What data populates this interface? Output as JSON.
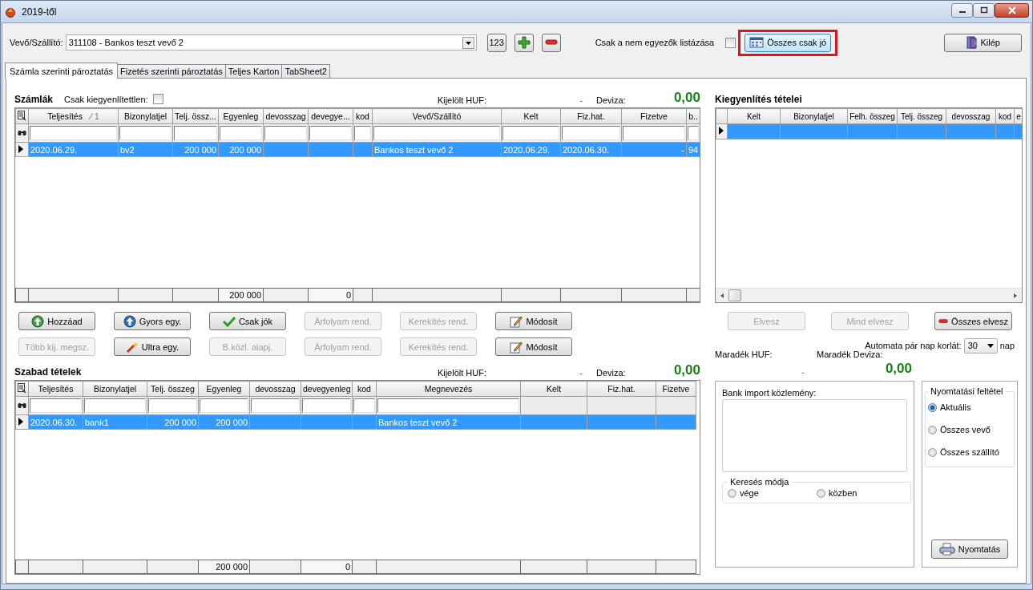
{
  "window": {
    "title": "2019-től"
  },
  "toolbar": {
    "customer_label": "Vevő/Szállító:",
    "customer_value": "311108 - Bankos teszt vevő 2",
    "number_button": "123",
    "mismatch_label": "Csak a nem egyezők listázása",
    "mismatch_checked": false,
    "all_ok_button": {
      "label": "Összes csak jó",
      "highlighted": true
    },
    "exit_button": "Kilép"
  },
  "tabs": [
    {
      "label": "Számla szerinti pároztatás",
      "selected": true
    },
    {
      "label": "Fizetés szerinti pároztatás",
      "selected": false
    },
    {
      "label": "Teljes Karton",
      "selected": false
    },
    {
      "label": "TabSheet2",
      "selected": false
    }
  ],
  "sections": [
    {
      "title": "Számlák",
      "filter_label": "Csak kiegyenlítettlen:",
      "filter_checked": false,
      "selected_huf_label": "Kijelölt HUF:",
      "selected_huf_value": "-",
      "currency_label": "Deviza:",
      "currency_value": "0,00",
      "grid": {
        "columns": [
          {
            "label": "Teljesítés",
            "sort": "1",
            "filter": true
          },
          {
            "label": "Bizonylatjel",
            "filter": true
          },
          {
            "label": "Telj. össz...",
            "filter": true
          },
          {
            "label": "Egyenleg",
            "filter": true,
            "total": "200 000"
          },
          {
            "label": "devosszag",
            "filter": true
          },
          {
            "label": "devegye...",
            "filter": true,
            "total": "0"
          },
          {
            "label": "kod",
            "filter": true
          },
          {
            "label": "Vevő/Szállító",
            "filter": true
          },
          {
            "label": "Kelt",
            "filter": true
          },
          {
            "label": "Fiz.hat.",
            "filter": true
          },
          {
            "label": "Fizetve",
            "filter": true
          },
          {
            "label": "b..",
            "filter": true
          }
        ],
        "rows": [
          {
            "selected": true,
            "cells": [
              "2020.06.29.",
              "bv2",
              "200 000",
              "200 000",
              null,
              null,
              null,
              "Bankos teszt vevő 2",
              "2020.06.29.",
              "2020.06.30.",
              "-",
              "94"
            ]
          }
        ]
      }
    },
    {
      "title": "Szabad tételek",
      "selected_huf_label": "Kijelölt HUF:",
      "selected_huf_value": "-",
      "currency_label": "Deviza:",
      "currency_value": "0,00",
      "grid": {
        "columns": [
          {
            "label": "Teljesítés",
            "filter": true
          },
          {
            "label": "Bizonylatjel",
            "filter": true
          },
          {
            "label": "Telj. összeg",
            "filter": true
          },
          {
            "label": "Egyenleg",
            "filter": true,
            "total": "200 000"
          },
          {
            "label": "devosszag",
            "filter": true
          },
          {
            "label": "devegyenleg",
            "filter": true,
            "total": "0"
          },
          {
            "label": "kod",
            "filter": true
          },
          {
            "label": "Megnevezés",
            "filter": true
          },
          {
            "label": "Kelt",
            "filter": false
          },
          {
            "label": "Fiz.hat.",
            "filter": false
          },
          {
            "label": "Fizetve",
            "filter": false
          }
        ],
        "rows": [
          {
            "selected": true,
            "cells": [
              "2020.06.30.",
              "bank1",
              "200 000",
              "200 000",
              null,
              null,
              null,
              "Bankos teszt vevő 2",
              null,
              null,
              null
            ]
          }
        ]
      }
    }
  ],
  "invoice_buttons": [
    [
      {
        "label": "Hozzáad",
        "kind": "add",
        "disabled": false
      },
      {
        "label": "Gyors egy.",
        "kind": "quick",
        "disabled": false
      },
      {
        "label": "Csak jók",
        "kind": "check",
        "disabled": false
      },
      {
        "label": "Árfolyam rend.",
        "kind": "plain",
        "disabled": true
      },
      {
        "label": "Kerekítés rend.",
        "kind": "plain",
        "disabled": true
      },
      {
        "label": "Módosít",
        "kind": "edit",
        "disabled": false
      }
    ],
    [
      {
        "label": "Több kij. megsz.",
        "kind": "plain",
        "disabled": true
      },
      {
        "label": "Ultra egy.",
        "kind": "wand",
        "disabled": false
      },
      {
        "label": "B.közl. alapj.",
        "kind": "plain",
        "disabled": true
      },
      {
        "label": "Árfolyam rend.",
        "kind": "plain",
        "disabled": true
      },
      {
        "label": "Kerekítés rend.",
        "kind": "plain",
        "disabled": true
      },
      {
        "label": "Módosít",
        "kind": "edit",
        "disabled": false
      }
    ]
  ],
  "settlement": {
    "title": "Kiegyenlítés tételei",
    "grid": {
      "columns": [
        {
          "label": "Kelt"
        },
        {
          "label": "Bizonylatjel"
        },
        {
          "label": "Felh. összeg"
        },
        {
          "label": "Telj. összeg"
        },
        {
          "label": "devosszag"
        },
        {
          "label": "kod"
        },
        {
          "label": "e"
        }
      ],
      "rows": [
        {
          "selected": true
        }
      ]
    }
  },
  "settlement_buttons": [
    {
      "label": "Elvesz",
      "kind": "plain",
      "disabled": true
    },
    {
      "label": "Mind elvesz",
      "kind": "plain",
      "disabled": true
    },
    {
      "label": "Összes elvesz",
      "kind": "remove",
      "disabled": false
    }
  ],
  "auto_pair": {
    "label": "Automata pár nap korlát:",
    "value": "30",
    "unit": "nap"
  },
  "remaining": {
    "huf_label": "Maradék HUF:",
    "huf_value": "-",
    "currency_label": "Maradék Deviza:",
    "currency_value": "0,00"
  },
  "bank_import": {
    "label": "Bank import közlemény:",
    "search_mode": {
      "title": "Keresés módja",
      "options": [
        {
          "label": "vége",
          "selected": false
        },
        {
          "label": "közben",
          "selected": false
        }
      ]
    }
  },
  "print": {
    "title": "Nyomtatási feltétel",
    "options": [
      {
        "label": "Aktuális",
        "selected": true
      },
      {
        "label": "Összes vevő",
        "selected": false
      },
      {
        "label": "Összes szállító",
        "selected": false
      }
    ],
    "button": "Nyomtatás"
  }
}
